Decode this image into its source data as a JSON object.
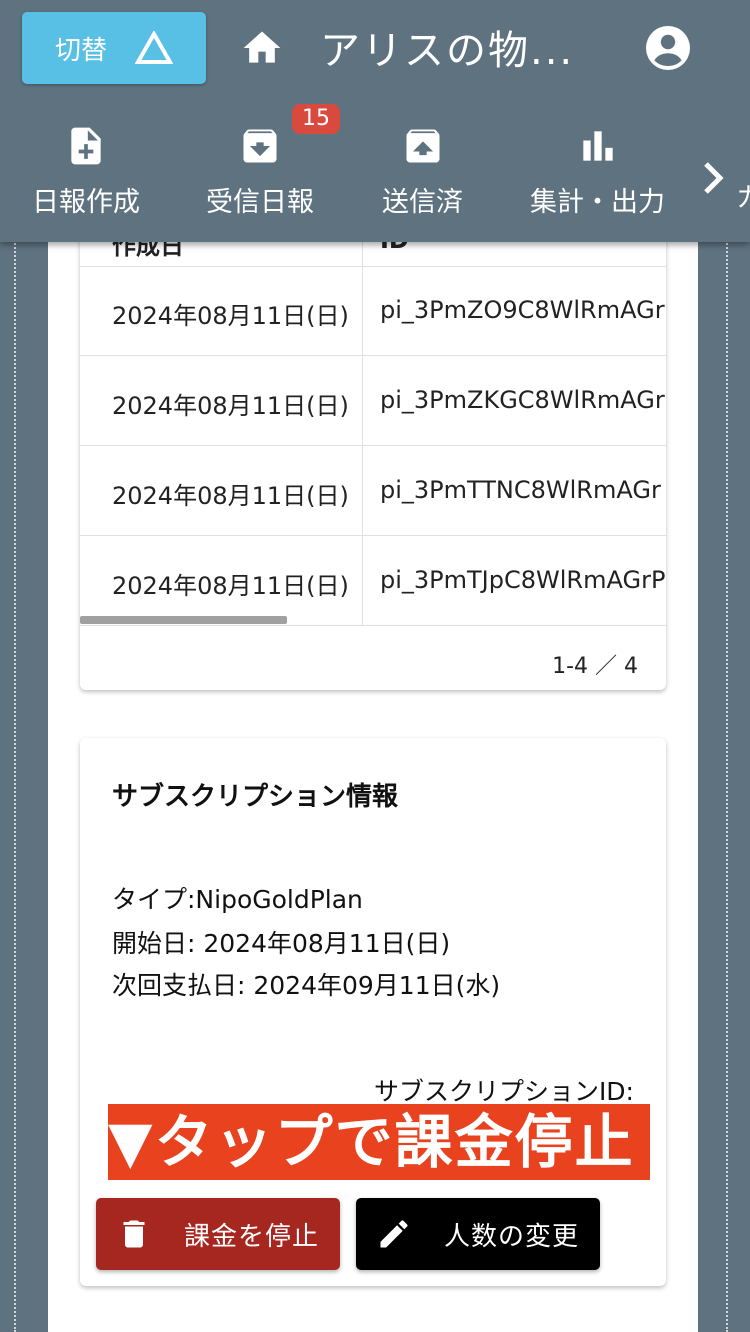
{
  "header": {
    "switch_label": "切替",
    "title": "アリスの物...",
    "nav": [
      {
        "label": "日報作成",
        "icon": "file-plus-icon"
      },
      {
        "label": "受信日報",
        "icon": "inbox-download-icon",
        "badge": "15"
      },
      {
        "label": "送信済",
        "icon": "inbox-upload-icon"
      },
      {
        "label": "集計・出力",
        "icon": "bar-chart-icon"
      }
    ],
    "nav_cut_text": "カ"
  },
  "payments_table": {
    "columns": [
      "作成日",
      "ID"
    ],
    "rows": [
      {
        "date": "2024年08月11日(日)",
        "id": "pi_3PmZO9C8WlRmAGr"
      },
      {
        "date": "2024年08月11日(日)",
        "id": "pi_3PmZKGC8WlRmAGr"
      },
      {
        "date": "2024年08月11日(日)",
        "id": "pi_3PmTTNC8WlRmAGr"
      },
      {
        "date": "2024年08月11日(日)",
        "id": "pi_3PmTJpC8WlRmAGrP"
      }
    ],
    "pagination": "1-4 ／ 4"
  },
  "subscription": {
    "title": "サブスクリプション情報",
    "type_line": "タイプ:NipoGoldPlan",
    "start_line": "開始日: 2024年08月11日(日)",
    "next_line": "次回支払日: 2024年09月11日(水)",
    "id_label": "サブスクリプションID:",
    "banner": "▼タップで課金停止",
    "stop_button": "課金を停止",
    "change_button": "人数の変更"
  },
  "colors": {
    "appbar": "#5e7280",
    "switch": "#58c0e5",
    "badge": "#d9493e",
    "banner": "#e8421f",
    "stop_button": "#a6271f",
    "change_button": "#000000"
  }
}
